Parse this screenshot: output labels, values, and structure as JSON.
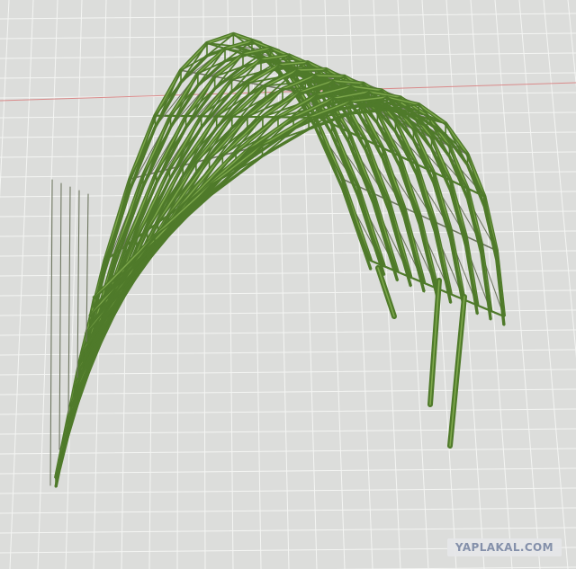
{
  "viewport": {
    "background_color": "#dcdddb",
    "grid_color": "#f4f5f3",
    "axis_line_color": "#d98a8a",
    "model_color": "#4f7a2a",
    "model_highlight_color": "#7ea84c",
    "secondary_member_color": "#6e7660"
  },
  "watermark": {
    "text": "YAPLAKAL.COM"
  }
}
